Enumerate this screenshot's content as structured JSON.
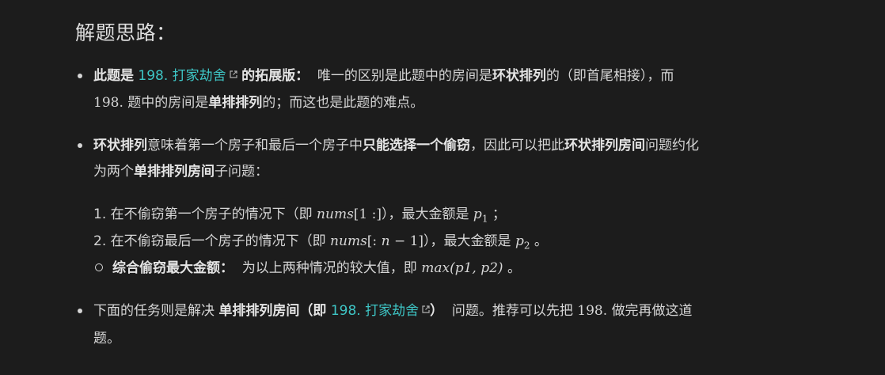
{
  "title": "解题思路：",
  "b1": {
    "l1_bold1": "此题是",
    "l1_link": "198. 打家劫舍",
    "l1_bold2": "的拓展版：",
    "l1_t1": "唯一的区别是此题中的房间是",
    "l1_bold3": "环状排列",
    "l1_t2": "的（即首尾相接），而",
    "l2_num": "198.",
    "l2_t1": "题中的房间是",
    "l2_bold": "单排排列",
    "l2_t2": "的；而这也是此题的难点。"
  },
  "b2": {
    "l1_bold1": "环状排列",
    "l1_t1": "意味着第一个房子和最后一个房子中",
    "l1_bold2": "只能选择一个偷窃",
    "l1_t2": "，因此可以把此",
    "l1_bold3": "环状排列房间",
    "l1_t3": "问题约化",
    "l2_t1": "为两个",
    "l2_bold": "单排排列房间",
    "l2_t2": "子问题："
  },
  "list": {
    "i1_num": "1.",
    "i1_t1": "在不偷窃第一个房子的情况下（即",
    "i1_math": "nums",
    "i1_math2": "[1 :]",
    "i1_t2": "），最大金额是",
    "i1_p": "p",
    "i1_sub": "1",
    "i1_end": "；",
    "i2_num": "2.",
    "i2_t1": "在不偷窃最后一个房子的情况下（即",
    "i2_math": "nums",
    "i2_math2a": "[:",
    "i2_math2b": "n",
    "i2_math2c": "− 1]",
    "i2_t2": "），最大金额是",
    "i2_p": "p",
    "i2_sub": "2",
    "i2_end": "。",
    "i3_bold": "综合偷窃最大金额：",
    "i3_t1": "为以上两种情况的较大值，即",
    "i3_math": "max",
    "i3_math2": "(p1, p2)",
    "i3_end": "。"
  },
  "b3": {
    "l1_t1": "下面的任务则是解决",
    "l1_bold1": "单排排列房间（即",
    "l1_link": "198. 打家劫舍",
    "l1_bold2": "）",
    "l1_t2": "问题。推荐可以先把",
    "l1_num": "198.",
    "l1_t3": "做完再做这道",
    "l2_t1": "题。"
  },
  "colors": {
    "background": "#1c1c1c",
    "text": "#d6d6d6",
    "link": "#3ec6c6"
  }
}
